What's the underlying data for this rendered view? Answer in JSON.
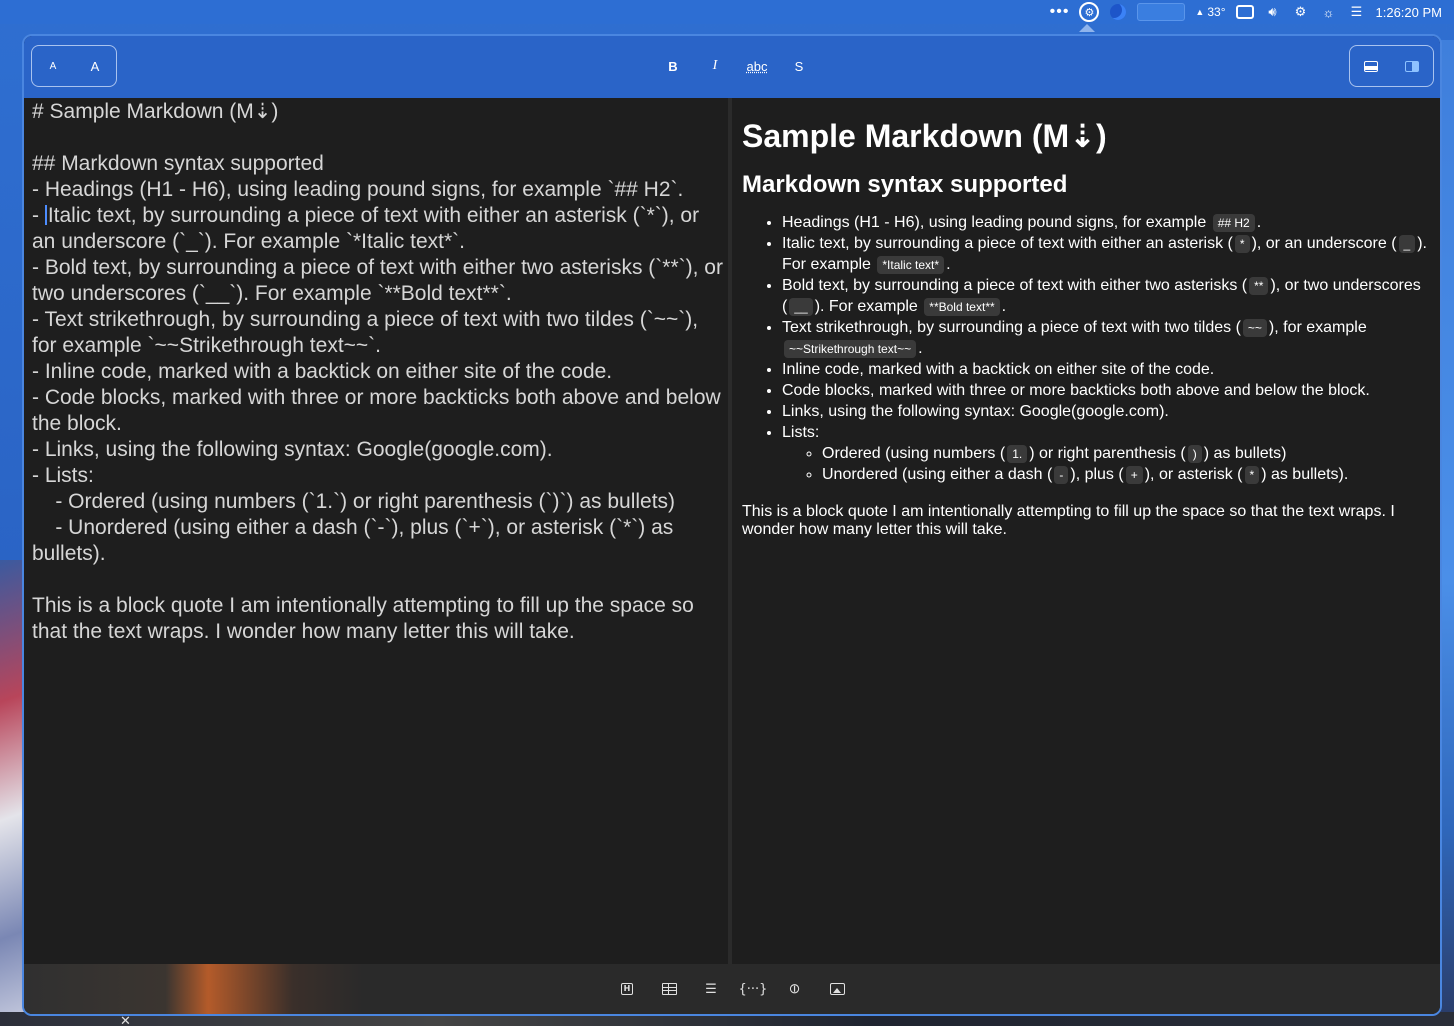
{
  "menubar": {
    "dots": "•••",
    "temperature": "33°",
    "temp_indicator": "▲",
    "time": "1:26:20 PM"
  },
  "toolbar": {
    "font_smaller": "A",
    "font_larger": "A",
    "bold": "B",
    "italic": "I",
    "spellcheck": "abc",
    "strikethrough": "S"
  },
  "editor": {
    "lines": [
      "# Sample Markdown (M⇣)",
      "",
      "## Markdown syntax supported",
      "- Headings (H1 - H6), using leading pound signs, for example `## H2`.",
      "Italic text, by surrounding a piece of text with either an asterisk (`*`), or an underscore (`_`). For example `*Italic text*`.",
      "- Bold text, by surrounding a piece of text with either two asterisks (`**`), or two underscores (`__`). For example `**Bold text**`.",
      "- Text strikethrough, by surrounding a piece of text with two tildes (`~~`), for example `~~Strikethrough text~~`.",
      "- Inline code, marked with a backtick on either site of the code.",
      "- Code blocks, marked with three or more backticks both above and below the block.",
      "- Links, using the following syntax: Google(google.com).",
      "- Lists:",
      "    - Ordered (using numbers (`1.`) or right parenthesis (`)`) as bullets)",
      "    - Unordered (using either a dash (`-`), plus (`+`), or asterisk (`*`) as bullets).",
      "",
      "This is a block quote I am intentionally attempting to fill up the space so that the text wraps. I wonder how many letter this will take."
    ],
    "cursor_line_prefix": "- "
  },
  "preview": {
    "h1": "Sample Markdown (M⇣)",
    "h2": "Markdown syntax supported",
    "items": {
      "headings_text": "Headings (H1 - H6), using leading pound signs, for example",
      "headings_code": "## H2",
      "italic_text_a": "Italic text, by surrounding a piece of text with either an asterisk (",
      "italic_code_a": "*",
      "italic_text_b": "), or an underscore (",
      "italic_code_b": "_",
      "italic_text_c": "). For example",
      "italic_code_c": "*Italic text*",
      "bold_text_a": "Bold text, by surrounding a piece of text with either two asterisks (",
      "bold_code_a": "**",
      "bold_text_b": "), or two underscores (",
      "bold_code_b": "__",
      "bold_text_c": "). For example",
      "bold_code_c": "**Bold text**",
      "strike_text_a": "Text strikethrough, by surrounding a piece of text with two tildes (",
      "strike_code_a": "~~",
      "strike_text_b": "), for example",
      "strike_code_b": "~~Strikethrough text~~",
      "inline_code": "Inline code, marked with a backtick on either site of the code.",
      "code_blocks": "Code blocks, marked with three or more backticks both above and below the block.",
      "links": "Links, using the following syntax: Google(google.com).",
      "lists": "Lists:",
      "ordered_text_a": "Ordered (using numbers (",
      "ordered_code_a": "1.",
      "ordered_text_b": ") or right parenthesis (",
      "ordered_code_b": ")",
      "ordered_text_c": ") as bullets)",
      "unordered_text_a": "Unordered (using either a dash (",
      "unordered_code_a": "-",
      "unordered_text_b": "), plus (",
      "unordered_code_b": "+",
      "unordered_text_c": "), or asterisk (",
      "unordered_code_c": "*",
      "unordered_text_d": ") as bullets)."
    },
    "quote": "This is a block quote I am intentionally attempting to fill up the space so that the text wraps. I wonder how many letter this will take."
  },
  "bottombar": {
    "heading_icon_label": "H",
    "list_icon": "☰",
    "code_icon": "{···}",
    "link_icon": "⊘"
  },
  "taskbar": {
    "close": "✕"
  }
}
